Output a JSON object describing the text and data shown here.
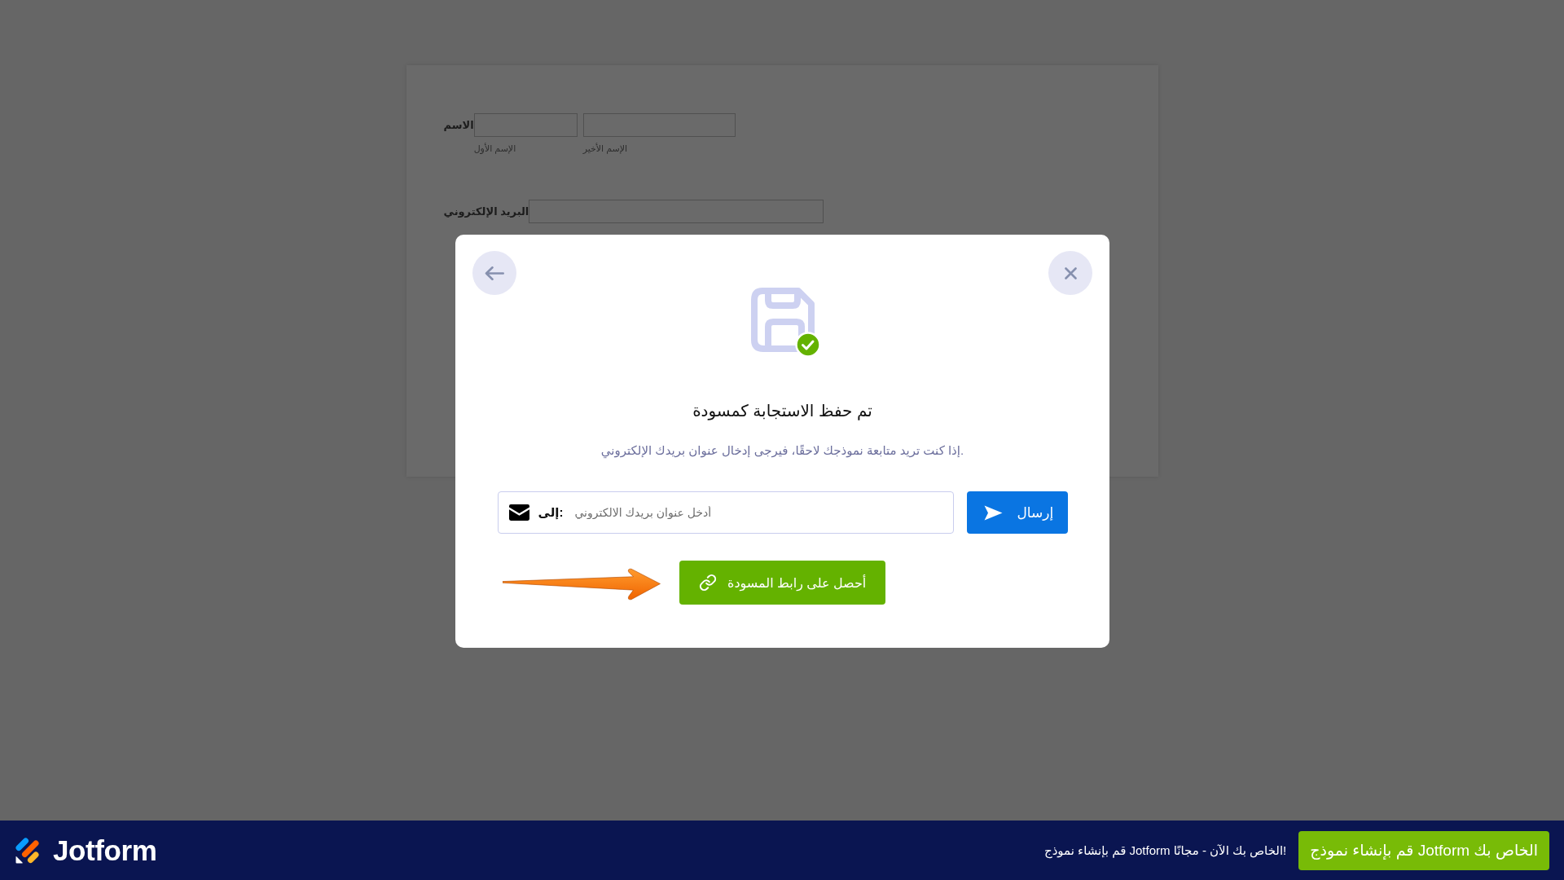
{
  "background_form": {
    "fields": [
      {
        "kind": "fullname",
        "label": "الاسم",
        "sublabels": [
          "الإسم الأخير",
          "الإسم الأول"
        ]
      },
      {
        "kind": "email",
        "label": "البريد الإلكتروني"
      }
    ]
  },
  "dialog": {
    "title": "تم حفظ الاستجابة كمسودة",
    "message": "إذا كنت تريد متابعة نموذجك لاحقًا، فيرجى إدخال عنوان بريدك الإلكتروني.",
    "email_field": {
      "label": "إلى:",
      "placeholder": "أدخل عنوان بريدك الالكتروني"
    },
    "send_button": "إرسال",
    "draft_link_button": "أحصل على رابط المسودة"
  },
  "footer": {
    "logo": "Jotform",
    "promo": "قم بإنشاء نموذج Jotform الخاص بك الآن - مجانًا!",
    "cta_button": "قم بإنشاء نموذج Jotform الخاص بك"
  }
}
